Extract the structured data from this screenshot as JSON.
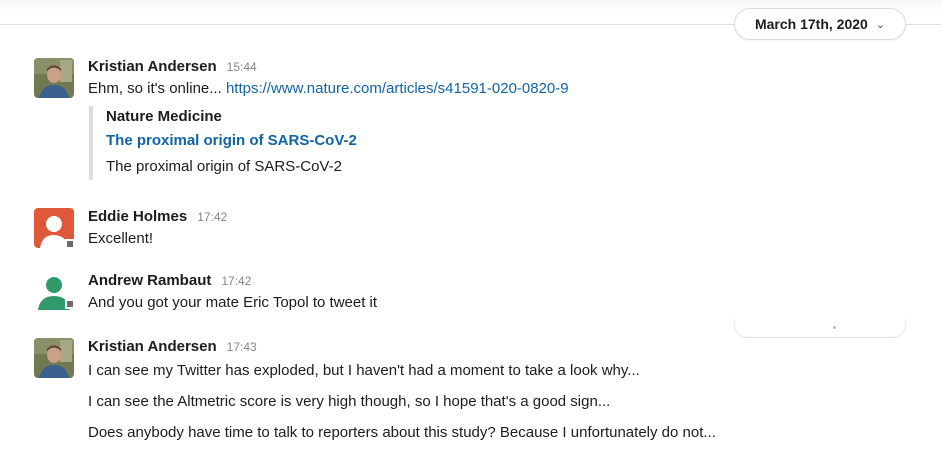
{
  "date_divider": {
    "label": "March 17th, 2020",
    "chevron": "chevron-down-icon"
  },
  "messages": [
    {
      "author": "Kristian Andersen",
      "time": "15:44",
      "text_prefix": "Ehm, so it's online...",
      "link": "https://www.nature.com/articles/s41591-020-0820-9",
      "attachment": {
        "source": "Nature Medicine",
        "title": "The proximal origin of SARS-CoV-2",
        "description": "The proximal origin of SARS-CoV-2"
      },
      "avatar": "photo-avatar"
    },
    {
      "author": "Eddie Holmes",
      "time": "17:42",
      "lines": [
        "Excellent!"
      ],
      "avatar": "default-avatar-orange",
      "avatar_color": "#e0583a"
    },
    {
      "author": "Andrew Rambaut",
      "time": "17:42",
      "lines": [
        "And you got your mate Eric Topol to tweet it"
      ],
      "avatar": "default-avatar-green",
      "avatar_color": "#2f9a6c"
    },
    {
      "author": "Kristian Andersen",
      "time": "17:43",
      "lines": [
        "I can see my Twitter has exploded, but I haven't had a moment to take a look why...",
        "I can see the Altmetric score is very high though, so I hope that's a good sign...",
        "Does anybody have time to talk to reporters about this study? Because I unfortunately do not..."
      ],
      "avatar": "photo-avatar"
    }
  ],
  "colors": {
    "link": "#1264a3",
    "text": "#1d1c1d",
    "timestamp": "#868686"
  }
}
